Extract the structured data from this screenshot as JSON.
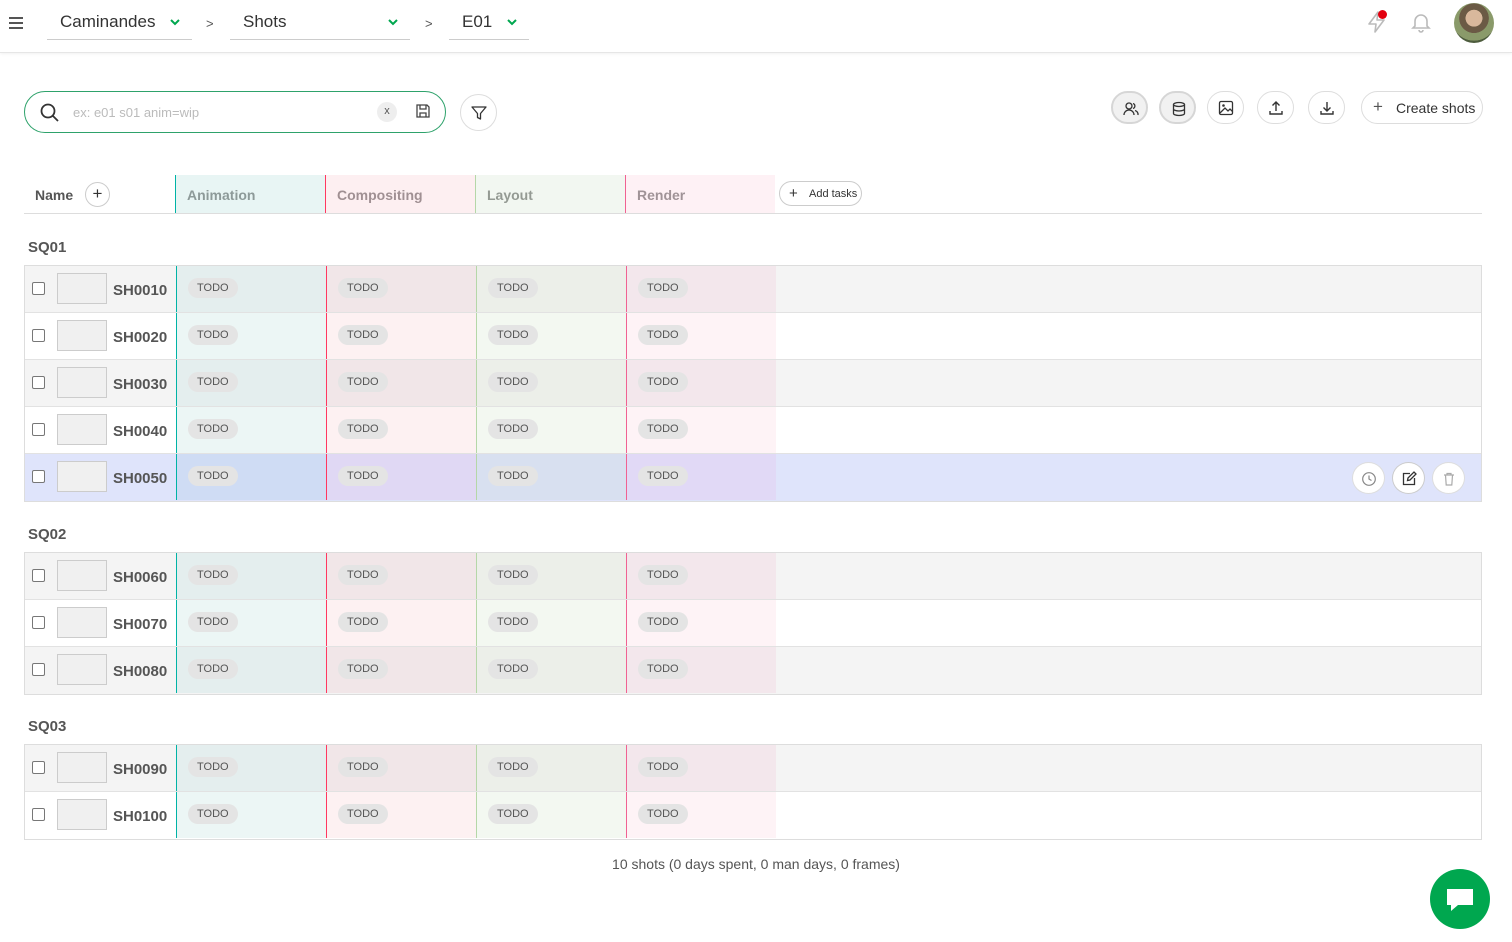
{
  "breadcrumb": {
    "production": "Caminandes",
    "section": "Shots",
    "episode": "E01",
    "separator": ">"
  },
  "search": {
    "placeholder": "ex: e01 s01 anim=wip",
    "clear_label": "x"
  },
  "toolbar": {
    "create_label": "Create shots"
  },
  "columns": {
    "name": "Name",
    "add_tasks": "Add tasks",
    "tasks": [
      {
        "label": "Animation",
        "color": "#00b3a6"
      },
      {
        "label": "Compositing",
        "color": "#ff3860"
      },
      {
        "label": "Layout",
        "color": "#7eb37e"
      },
      {
        "label": "Render",
        "color": "#f06292"
      }
    ]
  },
  "sequences": [
    {
      "name": "SQ01",
      "shots": [
        {
          "name": "SH0010",
          "statuses": [
            "TODO",
            "TODO",
            "TODO",
            "TODO"
          ]
        },
        {
          "name": "SH0020",
          "statuses": [
            "TODO",
            "TODO",
            "TODO",
            "TODO"
          ]
        },
        {
          "name": "SH0030",
          "statuses": [
            "TODO",
            "TODO",
            "TODO",
            "TODO"
          ]
        },
        {
          "name": "SH0040",
          "statuses": [
            "TODO",
            "TODO",
            "TODO",
            "TODO"
          ]
        },
        {
          "name": "SH0050",
          "statuses": [
            "TODO",
            "TODO",
            "TODO",
            "TODO"
          ]
        }
      ]
    },
    {
      "name": "SQ02",
      "shots": [
        {
          "name": "SH0060",
          "statuses": [
            "TODO",
            "TODO",
            "TODO",
            "TODO"
          ]
        },
        {
          "name": "SH0070",
          "statuses": [
            "TODO",
            "TODO",
            "TODO",
            "TODO"
          ]
        },
        {
          "name": "SH0080",
          "statuses": [
            "TODO",
            "TODO",
            "TODO",
            "TODO"
          ]
        }
      ]
    },
    {
      "name": "SQ03",
      "shots": [
        {
          "name": "SH0090",
          "statuses": [
            "TODO",
            "TODO",
            "TODO",
            "TODO"
          ]
        },
        {
          "name": "SH0100",
          "statuses": [
            "TODO",
            "TODO",
            "TODO",
            "TODO"
          ]
        }
      ]
    }
  ],
  "summary": "10 shots (0 days spent, 0 man days, 0 frames)",
  "colors": {
    "accent": "#00a74f",
    "notification_dot": "#e2000f",
    "hover_row": "#dfe4fb"
  }
}
